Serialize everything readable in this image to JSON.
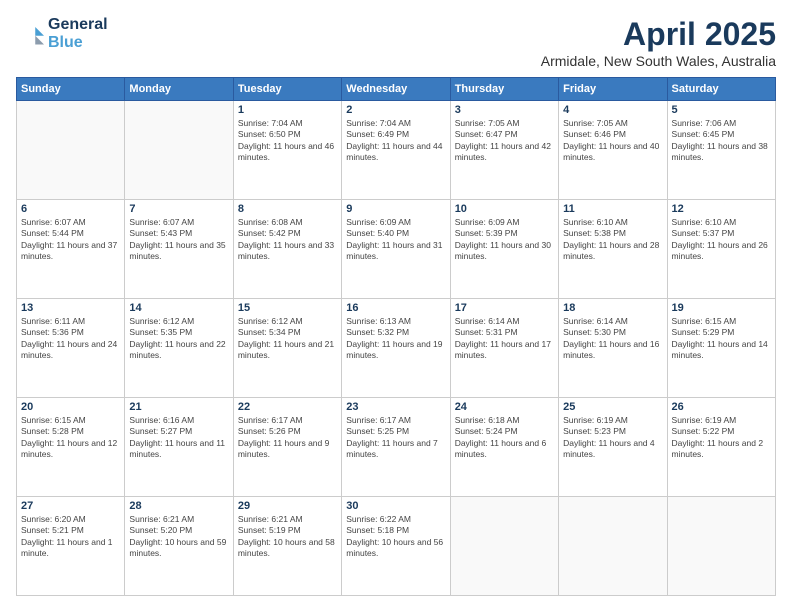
{
  "header": {
    "logo_line1": "General",
    "logo_line2": "Blue",
    "month": "April 2025",
    "location": "Armidale, New South Wales, Australia"
  },
  "days_of_week": [
    "Sunday",
    "Monday",
    "Tuesday",
    "Wednesday",
    "Thursday",
    "Friday",
    "Saturday"
  ],
  "weeks": [
    [
      {
        "day": "",
        "info": ""
      },
      {
        "day": "",
        "info": ""
      },
      {
        "day": "1",
        "info": "Sunrise: 7:04 AM\nSunset: 6:50 PM\nDaylight: 11 hours and 46 minutes."
      },
      {
        "day": "2",
        "info": "Sunrise: 7:04 AM\nSunset: 6:49 PM\nDaylight: 11 hours and 44 minutes."
      },
      {
        "day": "3",
        "info": "Sunrise: 7:05 AM\nSunset: 6:47 PM\nDaylight: 11 hours and 42 minutes."
      },
      {
        "day": "4",
        "info": "Sunrise: 7:05 AM\nSunset: 6:46 PM\nDaylight: 11 hours and 40 minutes."
      },
      {
        "day": "5",
        "info": "Sunrise: 7:06 AM\nSunset: 6:45 PM\nDaylight: 11 hours and 38 minutes."
      }
    ],
    [
      {
        "day": "6",
        "info": "Sunrise: 6:07 AM\nSunset: 5:44 PM\nDaylight: 11 hours and 37 minutes."
      },
      {
        "day": "7",
        "info": "Sunrise: 6:07 AM\nSunset: 5:43 PM\nDaylight: 11 hours and 35 minutes."
      },
      {
        "day": "8",
        "info": "Sunrise: 6:08 AM\nSunset: 5:42 PM\nDaylight: 11 hours and 33 minutes."
      },
      {
        "day": "9",
        "info": "Sunrise: 6:09 AM\nSunset: 5:40 PM\nDaylight: 11 hours and 31 minutes."
      },
      {
        "day": "10",
        "info": "Sunrise: 6:09 AM\nSunset: 5:39 PM\nDaylight: 11 hours and 30 minutes."
      },
      {
        "day": "11",
        "info": "Sunrise: 6:10 AM\nSunset: 5:38 PM\nDaylight: 11 hours and 28 minutes."
      },
      {
        "day": "12",
        "info": "Sunrise: 6:10 AM\nSunset: 5:37 PM\nDaylight: 11 hours and 26 minutes."
      }
    ],
    [
      {
        "day": "13",
        "info": "Sunrise: 6:11 AM\nSunset: 5:36 PM\nDaylight: 11 hours and 24 minutes."
      },
      {
        "day": "14",
        "info": "Sunrise: 6:12 AM\nSunset: 5:35 PM\nDaylight: 11 hours and 22 minutes."
      },
      {
        "day": "15",
        "info": "Sunrise: 6:12 AM\nSunset: 5:34 PM\nDaylight: 11 hours and 21 minutes."
      },
      {
        "day": "16",
        "info": "Sunrise: 6:13 AM\nSunset: 5:32 PM\nDaylight: 11 hours and 19 minutes."
      },
      {
        "day": "17",
        "info": "Sunrise: 6:14 AM\nSunset: 5:31 PM\nDaylight: 11 hours and 17 minutes."
      },
      {
        "day": "18",
        "info": "Sunrise: 6:14 AM\nSunset: 5:30 PM\nDaylight: 11 hours and 16 minutes."
      },
      {
        "day": "19",
        "info": "Sunrise: 6:15 AM\nSunset: 5:29 PM\nDaylight: 11 hours and 14 minutes."
      }
    ],
    [
      {
        "day": "20",
        "info": "Sunrise: 6:15 AM\nSunset: 5:28 PM\nDaylight: 11 hours and 12 minutes."
      },
      {
        "day": "21",
        "info": "Sunrise: 6:16 AM\nSunset: 5:27 PM\nDaylight: 11 hours and 11 minutes."
      },
      {
        "day": "22",
        "info": "Sunrise: 6:17 AM\nSunset: 5:26 PM\nDaylight: 11 hours and 9 minutes."
      },
      {
        "day": "23",
        "info": "Sunrise: 6:17 AM\nSunset: 5:25 PM\nDaylight: 11 hours and 7 minutes."
      },
      {
        "day": "24",
        "info": "Sunrise: 6:18 AM\nSunset: 5:24 PM\nDaylight: 11 hours and 6 minutes."
      },
      {
        "day": "25",
        "info": "Sunrise: 6:19 AM\nSunset: 5:23 PM\nDaylight: 11 hours and 4 minutes."
      },
      {
        "day": "26",
        "info": "Sunrise: 6:19 AM\nSunset: 5:22 PM\nDaylight: 11 hours and 2 minutes."
      }
    ],
    [
      {
        "day": "27",
        "info": "Sunrise: 6:20 AM\nSunset: 5:21 PM\nDaylight: 11 hours and 1 minute."
      },
      {
        "day": "28",
        "info": "Sunrise: 6:21 AM\nSunset: 5:20 PM\nDaylight: 10 hours and 59 minutes."
      },
      {
        "day": "29",
        "info": "Sunrise: 6:21 AM\nSunset: 5:19 PM\nDaylight: 10 hours and 58 minutes."
      },
      {
        "day": "30",
        "info": "Sunrise: 6:22 AM\nSunset: 5:18 PM\nDaylight: 10 hours and 56 minutes."
      },
      {
        "day": "",
        "info": ""
      },
      {
        "day": "",
        "info": ""
      },
      {
        "day": "",
        "info": ""
      }
    ]
  ]
}
